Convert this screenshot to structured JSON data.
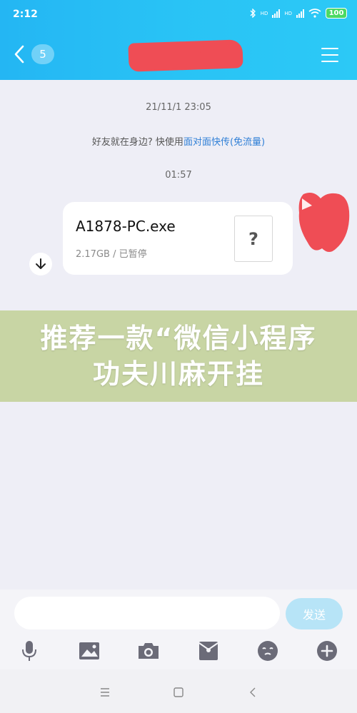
{
  "status_bar": {
    "time": "2:12",
    "battery": "100",
    "network_1": "HD",
    "network_2": "HD"
  },
  "header": {
    "back_count": "5"
  },
  "chat": {
    "timestamp_1": "21/11/1 23:05",
    "notice_prefix": "好友就在身边? 快使用",
    "notice_link": "面对面快传",
    "notice_suffix": "(免流量)",
    "timestamp_2": "01:57",
    "file": {
      "name": "A1878-PC.exe",
      "meta": "2.17GB / 已暂停",
      "icon_glyph": "?"
    }
  },
  "banner": {
    "text": "推荐一款“微信小程序功夫川麻开挂"
  },
  "input": {
    "placeholder": "",
    "send_label": "发送"
  },
  "colors": {
    "header": "#29c3f5",
    "link": "#2f7fd6",
    "banner": "#c8d5a4",
    "redaction": "#ef4d55",
    "send_button": "#b7e4f7"
  },
  "icons": [
    "back-chevron-icon",
    "ear-icon",
    "menu-icon",
    "download-icon",
    "file-unknown-icon",
    "microphone-icon",
    "image-icon",
    "camera-icon",
    "red-packet-icon",
    "emoji-icon",
    "plus-icon",
    "nav-menu-icon",
    "nav-home-icon",
    "nav-back-icon"
  ]
}
